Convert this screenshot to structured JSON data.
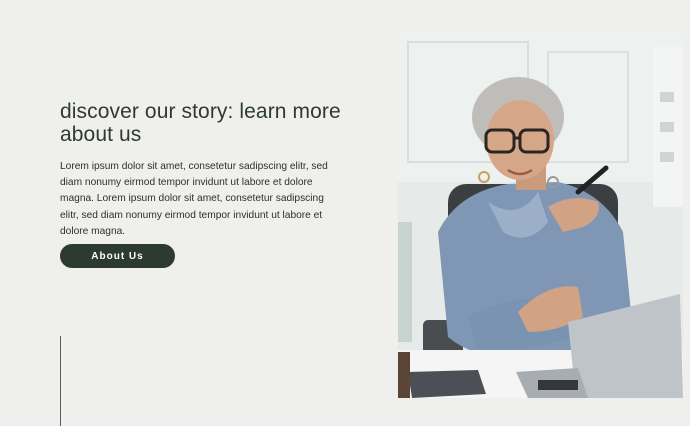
{
  "hero": {
    "heading": "discover our story: learn more about us",
    "paragraph": "Lorem ipsum dolor sit amet, consetetur sadipscing elitr, sed diam nonumy eirmod tempor invidunt ut labore et dolore magna. Lorem ipsum dolor sit amet, consetetur sadipscing elitr, sed diam nonumy eirmod tempor invidunt ut labore et dolore magna.",
    "button_label": "About Us"
  },
  "colors": {
    "background": "#efefed",
    "heading": "#2f3a33",
    "button": "#2c3a2f",
    "button_text": "#ffffff"
  },
  "image": {
    "subject": "smiling older woman with glasses at desk with laptop"
  }
}
